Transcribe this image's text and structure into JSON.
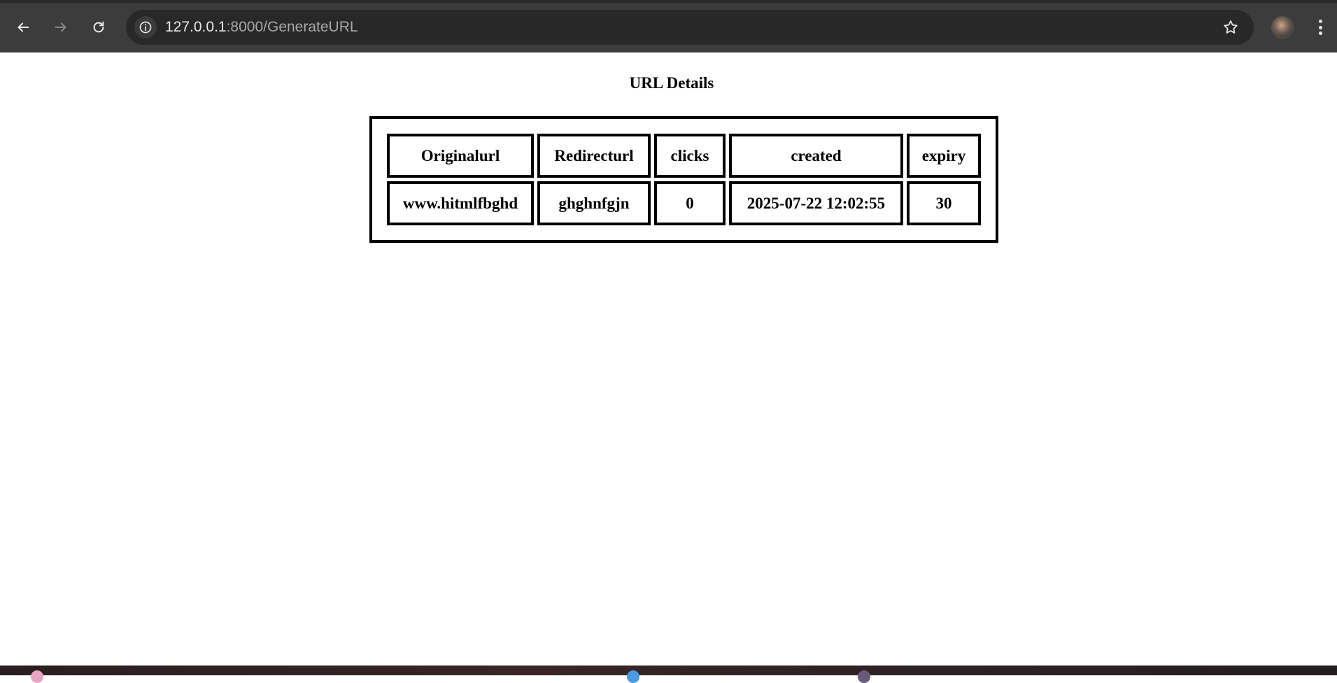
{
  "browser": {
    "url_host": "127.0.0.1",
    "url_rest": ":8000/GenerateURL",
    "icons": {
      "back": "arrow-left-icon",
      "forward": "arrow-right-icon",
      "reload": "reload-icon",
      "site_info": "info-icon",
      "bookmark": "star-icon",
      "menu": "kebab-menu-icon"
    }
  },
  "page": {
    "title": "URL Details",
    "table": {
      "headers": {
        "original": "Originalurl",
        "redirect": "Redirecturl",
        "clicks": "clicks",
        "created": "created",
        "expiry": "expiry"
      },
      "rows": [
        {
          "original": "www.hitmlfbghd",
          "redirect": "ghghnfgjn",
          "clicks": "0",
          "created": "2025-07-22 12:02:55",
          "expiry": "30"
        }
      ]
    }
  },
  "colors": {
    "toolbar": "#3c3c3c",
    "omnibox": "#282828",
    "page_bg": "#ffffff",
    "border": "#000000"
  }
}
